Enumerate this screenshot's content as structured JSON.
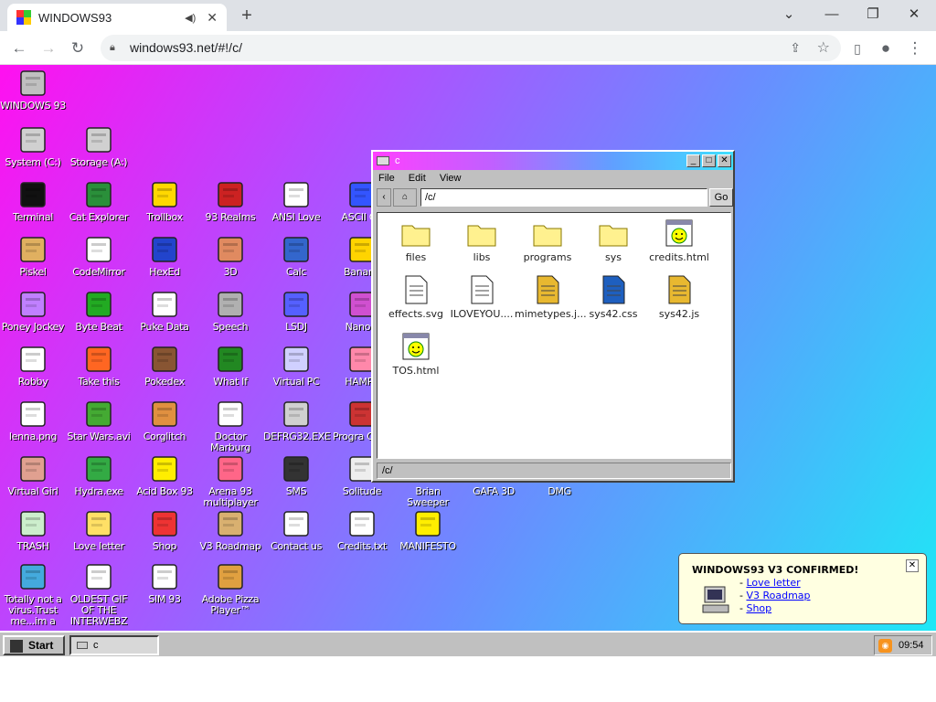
{
  "browser": {
    "tab_title": "WINDOWS93",
    "new_tab": "+",
    "address": "windows93.net/#!/c/",
    "controls": {
      "back": "←",
      "forward": "→",
      "reload": "↻",
      "minimize": "—",
      "restore": "❐",
      "close": "✕",
      "more": "⋮"
    }
  },
  "desktop": {
    "icons": [
      {
        "label": "WINDOWS 93",
        "icon": "computer-icon",
        "color": "#c0c0c0"
      },
      {
        "label": "System (C:)",
        "icon": "drive-icon",
        "color": "#d0d0d0"
      },
      {
        "label": "Storage (A:)",
        "icon": "floppy-drive-icon",
        "color": "#d0d0d0"
      },
      {
        "label": "Terminal",
        "icon": "terminal-icon",
        "color": "#111111"
      },
      {
        "label": "Cat Explorer",
        "icon": "cat-globe-icon",
        "color": "#2a8f3a"
      },
      {
        "label": "Trollbox",
        "icon": "trollbox-icon",
        "color": "#ffd800"
      },
      {
        "label": "93 Realms",
        "icon": "realms-icon",
        "color": "#cc2222"
      },
      {
        "label": "ANSI Love",
        "icon": "ansi-icon",
        "color": "#ffffff"
      },
      {
        "label": "ASCII Ga",
        "icon": "ascii-icon",
        "color": "#3355ff"
      },
      {
        "label": "Piskel",
        "icon": "palette-icon",
        "color": "#e0b060"
      },
      {
        "label": "CodeMirror",
        "icon": "codemirror-icon",
        "color": "#ffffff"
      },
      {
        "label": "HexEd",
        "icon": "hexed-icon",
        "color": "#2244cc"
      },
      {
        "label": "3D",
        "icon": "teapot-icon",
        "color": "#e08a60"
      },
      {
        "label": "Calc",
        "icon": "calculator-icon",
        "color": "#3366cc"
      },
      {
        "label": "Banana",
        "icon": "banana-icon",
        "color": "#ffd400"
      },
      {
        "label": "Poney Jockey",
        "icon": "pony-icon",
        "color": "#c080ff"
      },
      {
        "label": "Byte Beat",
        "icon": "bytebeat-icon",
        "color": "#22aa22"
      },
      {
        "label": "Puke Data",
        "icon": "pd-icon",
        "color": "#ffffff"
      },
      {
        "label": "Speech",
        "icon": "speech-face-icon",
        "color": "#b0b0b0"
      },
      {
        "label": "LSDJ",
        "icon": "lsdj-icon",
        "color": "#5560ff"
      },
      {
        "label": "Nanolo",
        "icon": "nanolo-icon",
        "color": "#d050d0"
      },
      {
        "label": "Robby",
        "icon": "stickman-icon",
        "color": "#ffffff"
      },
      {
        "label": "Take this",
        "icon": "take-this-icon",
        "color": "#ff6622"
      },
      {
        "label": "Pokedex",
        "icon": "pokedex-icon",
        "color": "#885533"
      },
      {
        "label": "What If",
        "icon": "what-if-icon",
        "color": "#228822"
      },
      {
        "label": "Virtual PC",
        "icon": "virtual-pc-icon",
        "color": "#d0d0ff"
      },
      {
        "label": "HAMPS",
        "icon": "hamster-icon",
        "color": "#ff88aa"
      },
      {
        "label": "lenna.png",
        "icon": "image-file-icon",
        "color": "#ffffff"
      },
      {
        "label": "Star Wars.avi",
        "icon": "yoda-icon",
        "color": "#44aa33"
      },
      {
        "label": "Corglitch",
        "icon": "corgi-icon",
        "color": "#e09040"
      },
      {
        "label": "Doctor Marburg",
        "icon": "doctor-icon",
        "color": "#ffffff"
      },
      {
        "label": "DEFRG32.EXE",
        "icon": "defrag-icon",
        "color": "#d0d0d0"
      },
      {
        "label": "Progra Ques",
        "icon": "quest-icon",
        "color": "#cc3333"
      },
      {
        "label": "Virtual Girl",
        "icon": "virtual-girl-icon",
        "color": "#e0a090"
      },
      {
        "label": "Hydra.exe",
        "icon": "hydra-icon",
        "color": "#33aa44"
      },
      {
        "label": "Acid Box 93",
        "icon": "smiley-icon",
        "color": "#ffee00"
      },
      {
        "label": "Arena 93 multiplayer",
        "icon": "cube-icon",
        "color": "#ff6688"
      },
      {
        "label": "SMS",
        "icon": "sms-console-icon",
        "color": "#333333"
      },
      {
        "label": "Solitude",
        "icon": "solitude-icon",
        "color": "#eeeeee"
      },
      {
        "label": "Brian Sweeper",
        "icon": "mine-icon",
        "color": "#ffffff"
      },
      {
        "label": "GAFA 3D",
        "icon": "gafa-icon",
        "color": "#ffffff"
      },
      {
        "label": "DMG",
        "icon": "dmg-icon",
        "color": "#ffffff"
      },
      {
        "label": "TRASH",
        "icon": "trash-icon",
        "color": "#cceecc"
      },
      {
        "label": "Love letter",
        "icon": "envelope-icon",
        "color": "#ffe066"
      },
      {
        "label": "Shop",
        "icon": "gift-icon",
        "color": "#ee3333"
      },
      {
        "label": "V3 Roadmap",
        "icon": "map-icon",
        "color": "#d9b070"
      },
      {
        "label": "Contact us",
        "icon": "contact-icon",
        "color": "#ffffff"
      },
      {
        "label": "Credits.txt",
        "icon": "text-file-icon",
        "color": "#ffffff"
      },
      {
        "label": "MANIFESTO",
        "icon": "question-icon",
        "color": "#ffee00"
      },
      {
        "label": "Totally not a virus.Trust me...im a",
        "icon": "dolphin-icon",
        "color": "#44aadd"
      },
      {
        "label": "OLDEST GIF OF THE INTERWEBZ",
        "icon": "gif-file-icon",
        "color": "#ffffff"
      },
      {
        "label": "SIM 93",
        "icon": "sim-icon",
        "color": "#ffffff"
      },
      {
        "label": "Adobe Pizza Player™",
        "icon": "pizza-icon",
        "color": "#e0a040"
      }
    ]
  },
  "explorer": {
    "title": "c",
    "menu": [
      "File",
      "Edit",
      "View"
    ],
    "path": "/c/",
    "go": "Go",
    "status": "/c/",
    "items": [
      {
        "label": "files",
        "icon": "folder-icon",
        "type": "folder"
      },
      {
        "label": "libs",
        "icon": "folder-icon",
        "type": "folder"
      },
      {
        "label": "programs",
        "icon": "folder-icon",
        "type": "folder"
      },
      {
        "label": "sys",
        "icon": "folder-icon",
        "type": "folder"
      },
      {
        "label": "credits.html",
        "icon": "html-file-icon",
        "type": "html"
      },
      {
        "label": "effects.svg",
        "icon": "svg-file-icon",
        "type": "svg"
      },
      {
        "label": "ILOVEYOU....",
        "icon": "text-file-icon",
        "type": "txt"
      },
      {
        "label": "mimetypes.j...",
        "icon": "js-file-icon",
        "type": "js"
      },
      {
        "label": "sys42.css",
        "icon": "css-file-icon",
        "type": "css"
      },
      {
        "label": "sys42.js",
        "icon": "js-file-icon",
        "type": "js2"
      },
      {
        "label": "TOS.html",
        "icon": "html-file-icon",
        "type": "html"
      }
    ]
  },
  "notification": {
    "title": "WINDOWS93 V3 CONFIRMED!",
    "links": [
      "Love letter",
      "V3 Roadmap",
      "Shop"
    ],
    "prefix": "- ",
    "close": "✕"
  },
  "taskbar": {
    "start": "Start",
    "task": "c",
    "clock": "09:54"
  }
}
